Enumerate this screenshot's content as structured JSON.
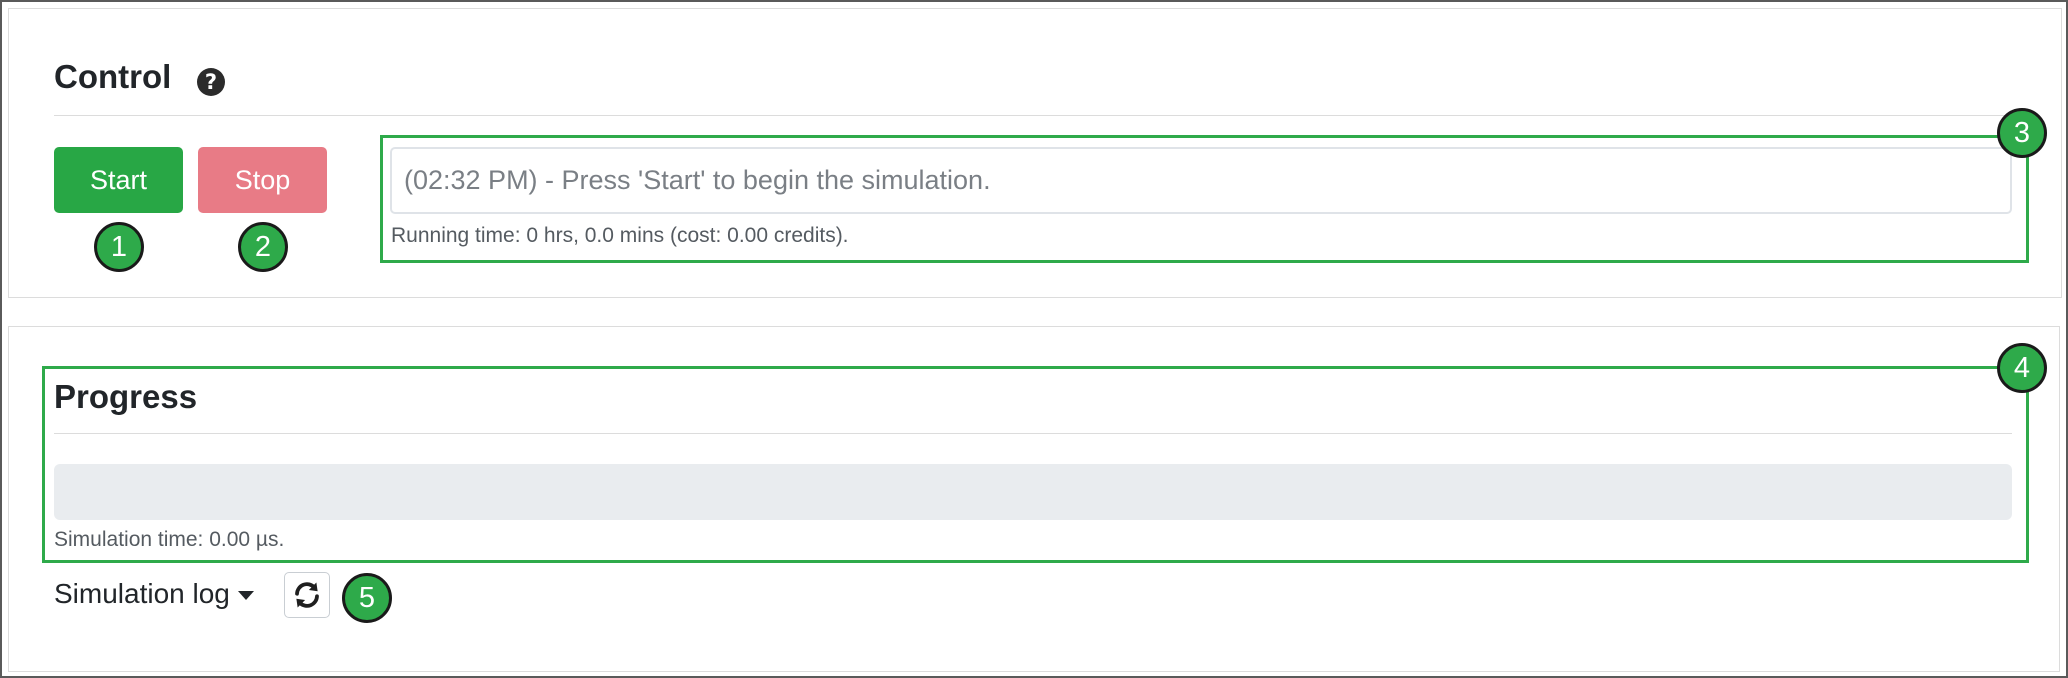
{
  "control": {
    "title": "Control",
    "help_icon": "question-circle-icon",
    "start_label": "Start",
    "stop_label": "Stop",
    "status_message": "(02:32 PM) - Press 'Start' to begin the simulation.",
    "running_time": "Running time: 0 hrs, 0.0 mins (cost: 0.00 credits)."
  },
  "progress": {
    "title": "Progress",
    "value": 0,
    "simulation_time": "Simulation time: 0.00 µs."
  },
  "log": {
    "label": "Simulation log",
    "refresh_icon": "refresh-icon"
  },
  "callouts": [
    "1",
    "2",
    "3",
    "4",
    "5"
  ],
  "colors": {
    "start": "#28a745",
    "stop": "#e87b86",
    "callout": "#2eaa4a",
    "progress_track": "#e9ecef"
  }
}
